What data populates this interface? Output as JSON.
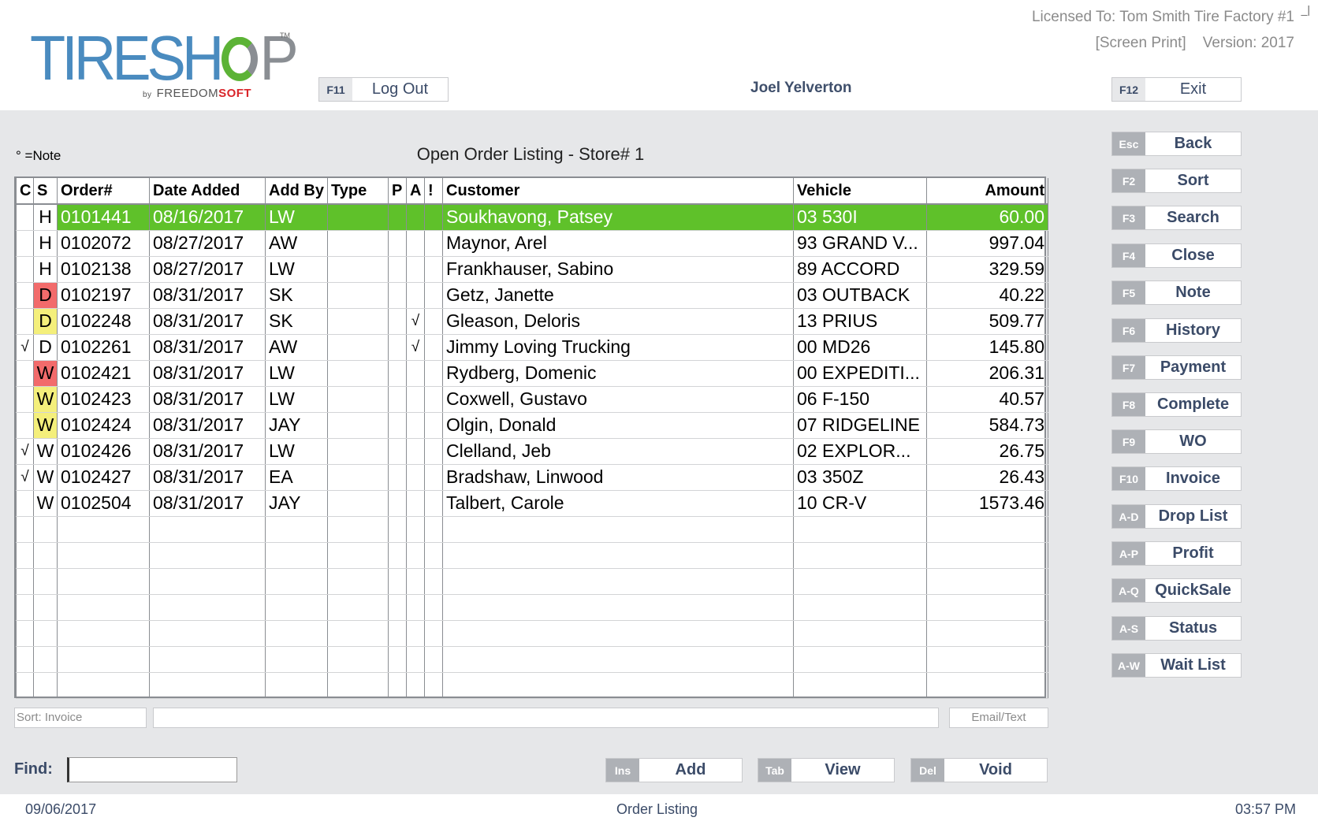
{
  "header": {
    "logo_main": "TIRESHOP",
    "logo_tm": "TM",
    "logo_by": "by",
    "logo_brand_left": "FREEDOM",
    "logo_brand_right": "SOFT",
    "license_line": "Licensed To: Tom Smith Tire Factory #1",
    "screen_print": "[Screen Print]",
    "version": "Version: 2017",
    "corner_mark": "_|",
    "user_name": "Joel Yelverton",
    "logout": {
      "key": "F11",
      "label": "Log Out"
    },
    "exit": {
      "key": "F12",
      "label": "Exit"
    }
  },
  "colors": {
    "selected_row": "#5fc12a",
    "status_red": "#f26b6b",
    "status_yellow": "#f4ef7b",
    "key_bg": "#aeb1b6",
    "label_text": "#3b4b68",
    "logo_blue": "#4a8bbf",
    "logo_green": "#5cb336",
    "logo_red": "#d9252a"
  },
  "page": {
    "note_legend": "° =Note",
    "title": "Open Order Listing - Store# 1"
  },
  "table": {
    "columns": [
      "C",
      "S",
      "Order#",
      "Date Added",
      "Add By",
      "Type",
      "P",
      "A",
      "!",
      "Customer",
      "Vehicle",
      "Amount"
    ],
    "rows": [
      {
        "c": "",
        "s": "H",
        "s_color": "",
        "order": "0101441",
        "date": "08/16/2017",
        "add_by": "LW",
        "type": "",
        "p": "",
        "a": "",
        "bang": "",
        "customer": "Soukhavong, Patsey",
        "vehicle": "03 530I",
        "amount": "60.00",
        "selected": true
      },
      {
        "c": "",
        "s": "H",
        "s_color": "",
        "order": "0102072",
        "date": "08/27/2017",
        "add_by": "AW",
        "type": "",
        "p": "",
        "a": "",
        "bang": "",
        "customer": "Maynor, Arel",
        "vehicle": "93 GRAND V...",
        "amount": "997.04",
        "selected": false
      },
      {
        "c": "",
        "s": "H",
        "s_color": "",
        "order": "0102138",
        "date": "08/27/2017",
        "add_by": "LW",
        "type": "",
        "p": "",
        "a": "",
        "bang": "",
        "customer": "Frankhauser, Sabino",
        "vehicle": "89 ACCORD",
        "amount": "329.59",
        "selected": false
      },
      {
        "c": "",
        "s": "D",
        "s_color": "red",
        "order": "0102197",
        "date": "08/31/2017",
        "add_by": "SK",
        "type": "",
        "p": "",
        "a": "",
        "bang": "",
        "customer": "Getz, Janette",
        "vehicle": "03 OUTBACK",
        "amount": "40.22",
        "selected": false
      },
      {
        "c": "",
        "s": "D",
        "s_color": "yellow",
        "order": "0102248",
        "date": "08/31/2017",
        "add_by": "SK",
        "type": "",
        "p": "",
        "a": "√",
        "bang": "",
        "customer": "Gleason, Deloris",
        "vehicle": "13 PRIUS",
        "amount": "509.77",
        "selected": false
      },
      {
        "c": "√",
        "s": "D",
        "s_color": "",
        "order": "0102261",
        "date": "08/31/2017",
        "add_by": "AW",
        "type": "",
        "p": "",
        "a": "√",
        "bang": "",
        "customer": "Jimmy Loving Trucking",
        "vehicle": "00 MD26",
        "amount": "145.80",
        "selected": false
      },
      {
        "c": "",
        "s": "W",
        "s_color": "red",
        "order": "0102421",
        "date": "08/31/2017",
        "add_by": "LW",
        "type": "",
        "p": "",
        "a": "",
        "bang": "",
        "customer": "Rydberg, Domenic",
        "vehicle": "00 EXPEDITI...",
        "amount": "206.31",
        "selected": false
      },
      {
        "c": "",
        "s": "W",
        "s_color": "yellow",
        "order": "0102423",
        "date": "08/31/2017",
        "add_by": "LW",
        "type": "",
        "p": "",
        "a": "",
        "bang": "",
        "customer": "Coxwell, Gustavo",
        "vehicle": "06 F-150",
        "amount": "40.57",
        "selected": false
      },
      {
        "c": "",
        "s": "W",
        "s_color": "yellow",
        "order": "0102424",
        "date": "08/31/2017",
        "add_by": "JAY",
        "type": "",
        "p": "",
        "a": "",
        "bang": "",
        "customer": "Olgin, Donald",
        "vehicle": "07 RIDGELINE",
        "amount": "584.73",
        "selected": false
      },
      {
        "c": "√",
        "s": "W",
        "s_color": "",
        "order": "0102426",
        "date": "08/31/2017",
        "add_by": "LW",
        "type": "",
        "p": "",
        "a": "",
        "bang": "",
        "customer": "Clelland, Jeb",
        "vehicle": "02 EXPLOR...",
        "amount": "26.75",
        "selected": false
      },
      {
        "c": "√",
        "s": "W",
        "s_color": "",
        "order": "0102427",
        "date": "08/31/2017",
        "add_by": "EA",
        "type": "",
        "p": "",
        "a": "",
        "bang": "",
        "customer": "Bradshaw, Linwood",
        "vehicle": "03 350Z",
        "amount": "26.43",
        "selected": false
      },
      {
        "c": "",
        "s": "W",
        "s_color": "",
        "order": "0102504",
        "date": "08/31/2017",
        "add_by": "JAY",
        "type": "",
        "p": "",
        "a": "",
        "bang": "",
        "customer": "Talbert, Carole",
        "vehicle": "10 CR-V",
        "amount": "1573.46",
        "selected": false
      }
    ],
    "empty_rows": 7
  },
  "footer_fields": {
    "sort": "Sort: Invoice",
    "email_text": "Email/Text"
  },
  "find": {
    "label": "Find:",
    "value": ""
  },
  "bottom_buttons": [
    {
      "key": "Ins",
      "label": "Add"
    },
    {
      "key": "Tab",
      "label": "View"
    },
    {
      "key": "Del",
      "label": "Void"
    }
  ],
  "side_buttons": [
    {
      "key": "Esc",
      "label": "Back"
    },
    {
      "key": "F2",
      "label": "Sort"
    },
    {
      "key": "F3",
      "label": "Search"
    },
    {
      "key": "F4",
      "label": "Close"
    },
    {
      "key": "F5",
      "label": "Note"
    },
    {
      "key": "F6",
      "label": "History"
    },
    {
      "key": "F7",
      "label": "Payment"
    },
    {
      "key": "F8",
      "label": "Complete"
    },
    {
      "key": "F9",
      "label": "WO"
    },
    {
      "key": "F10",
      "label": "Invoice"
    },
    {
      "key": "A-D",
      "label": "Drop List"
    },
    {
      "key": "A-P",
      "label": "Profit"
    },
    {
      "key": "A-Q",
      "label": "QuickSale"
    },
    {
      "key": "A-S",
      "label": "Status"
    },
    {
      "key": "A-W",
      "label": "Wait List"
    }
  ],
  "status_bar": {
    "date": "09/06/2017",
    "screen": "Order Listing",
    "time": "03:57 PM"
  }
}
